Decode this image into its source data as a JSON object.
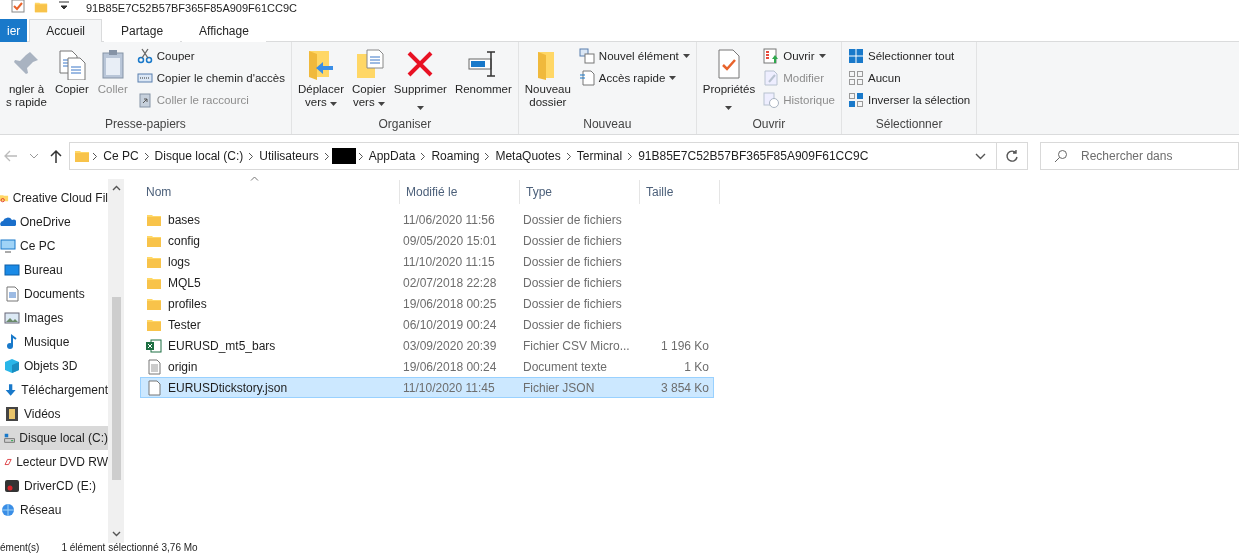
{
  "title_bar": {
    "title": "91B85E7C52B57BF365F85A909F61CC9C"
  },
  "ribbon_tabs": [
    {
      "label": "ier",
      "kind": "file",
      "selected": false
    },
    {
      "label": "Accueil",
      "kind": "tab",
      "selected": true
    },
    {
      "label": "Partage",
      "kind": "tab",
      "selected": false
    },
    {
      "label": "Affichage",
      "kind": "tab",
      "selected": false
    }
  ],
  "ribbon_groups": [
    {
      "label": "Presse-papiers",
      "large": [
        {
          "lines": [
            "ngler à",
            "s rapide"
          ],
          "disabled": false,
          "dropdown": false
        },
        {
          "lines": [
            "Copier"
          ],
          "disabled": false,
          "dropdown": false
        },
        {
          "lines": [
            "Coller"
          ],
          "disabled": true,
          "dropdown": false
        }
      ],
      "small": [
        {
          "label": "Couper",
          "disabled": false,
          "dropdown": false
        },
        {
          "label": "Copier le chemin d'accès",
          "disabled": false,
          "dropdown": false
        },
        {
          "label": "Coller le raccourci",
          "disabled": true,
          "dropdown": false
        }
      ]
    },
    {
      "label": "Organiser",
      "large": [
        {
          "lines": [
            "Déplacer",
            "vers"
          ],
          "disabled": false,
          "dropdown": true
        },
        {
          "lines": [
            "Copier",
            "vers"
          ],
          "disabled": false,
          "dropdown": true
        },
        {
          "lines": [
            "Supprimer"
          ],
          "disabled": false,
          "dropdown": true
        },
        {
          "lines": [
            "Renommer"
          ],
          "disabled": false,
          "dropdown": false
        }
      ]
    },
    {
      "label": "Nouveau",
      "large": [
        {
          "lines": [
            "Nouveau",
            "dossier"
          ],
          "disabled": false,
          "dropdown": false
        }
      ],
      "small": [
        {
          "label": "Nouvel élément",
          "disabled": false,
          "dropdown": true
        },
        {
          "label": "Accès rapide",
          "disabled": false,
          "dropdown": true
        }
      ]
    },
    {
      "label": "Ouvrir",
      "large": [
        {
          "lines": [
            "Propriétés"
          ],
          "disabled": false,
          "dropdown": true
        }
      ],
      "small": [
        {
          "label": "Ouvrir",
          "disabled": false,
          "dropdown": true
        },
        {
          "label": "Modifier",
          "disabled": true,
          "dropdown": false
        },
        {
          "label": "Historique",
          "disabled": true,
          "dropdown": false
        }
      ]
    },
    {
      "label": "Sélectionner",
      "small": [
        {
          "label": "Sélectionner tout",
          "disabled": false,
          "dropdown": false
        },
        {
          "label": "Aucun",
          "disabled": false,
          "dropdown": false
        },
        {
          "label": "Inverser la sélection",
          "disabled": false,
          "dropdown": false
        }
      ]
    }
  ],
  "address_bar": {
    "back_disabled": true,
    "breadcrumbs": [
      {
        "label": "Ce PC",
        "redacted": false
      },
      {
        "label": "Disque local (C:)",
        "redacted": false
      },
      {
        "label": "Utilisateurs",
        "redacted": false
      },
      {
        "redacted": true
      },
      {
        "label": "AppData",
        "redacted": false
      },
      {
        "label": "Roaming",
        "redacted": false
      },
      {
        "label": "MetaQuotes",
        "redacted": false
      },
      {
        "label": "Terminal",
        "redacted": false
      },
      {
        "label": "91B85E7C52B57BF365F85A909F61CC9C",
        "redacted": false
      }
    ],
    "search": {
      "placeholder": "Rechercher dans"
    }
  },
  "sidebar": {
    "items": [
      {
        "label": "Creative Cloud Fil",
        "selected": false
      },
      {
        "label": "OneDrive",
        "selected": false
      },
      {
        "label": "Ce PC",
        "selected": false,
        "children": [
          {
            "label": "Bureau",
            "selected": false
          },
          {
            "label": "Documents",
            "selected": false
          },
          {
            "label": "Images",
            "selected": false
          },
          {
            "label": "Musique",
            "selected": false
          },
          {
            "label": "Objets 3D",
            "selected": false
          },
          {
            "label": "Téléchargement",
            "selected": false
          },
          {
            "label": "Vidéos",
            "selected": false
          },
          {
            "label": "Disque local (C:)",
            "selected": true
          },
          {
            "label": "Lecteur DVD RW",
            "selected": false
          },
          {
            "label": "DriverCD (E:)",
            "selected": false
          }
        ]
      },
      {
        "label": "Réseau",
        "selected": false
      }
    ]
  },
  "file_list": {
    "columns": [
      "Nom",
      "Modifié le",
      "Type",
      "Taille"
    ],
    "rows": [
      {
        "kind": "folder",
        "name": "bases",
        "modified": "11/06/2020 11:56",
        "type": "Dossier de fichiers",
        "selected": false
      },
      {
        "kind": "folder",
        "name": "config",
        "modified": "09/05/2020 15:01",
        "type": "Dossier de fichiers",
        "selected": false
      },
      {
        "kind": "folder",
        "name": "logs",
        "modified": "11/10/2020 11:15",
        "type": "Dossier de fichiers",
        "selected": false
      },
      {
        "kind": "folder",
        "name": "MQL5",
        "modified": "02/07/2018 22:28",
        "type": "Dossier de fichiers",
        "selected": false
      },
      {
        "kind": "folder",
        "name": "profiles",
        "modified": "19/06/2018 00:25",
        "type": "Dossier de fichiers",
        "selected": false
      },
      {
        "kind": "folder",
        "name": "Tester",
        "modified": "06/10/2019 00:24",
        "type": "Dossier de fichiers",
        "selected": false
      },
      {
        "kind": "excel",
        "name": "EURUSD_mt5_bars",
        "modified": "03/09/2020 20:39",
        "type": "Fichier CSV Micro...",
        "size": "1 196 Ko",
        "selected": false
      },
      {
        "kind": "text",
        "name": "origin",
        "modified": "19/06/2018 00:24",
        "type": "Document texte",
        "size": "1 Ko",
        "selected": false
      },
      {
        "kind": "file",
        "name": "EURUSDtickstory.json",
        "modified": "11/10/2020 11:45",
        "type": "Fichier JSON",
        "size": "3 854 Ko",
        "selected": true
      }
    ]
  },
  "status_bar": {
    "count": "ément(s)",
    "selection": "1 élément sélectionné 3,76 Mo"
  }
}
